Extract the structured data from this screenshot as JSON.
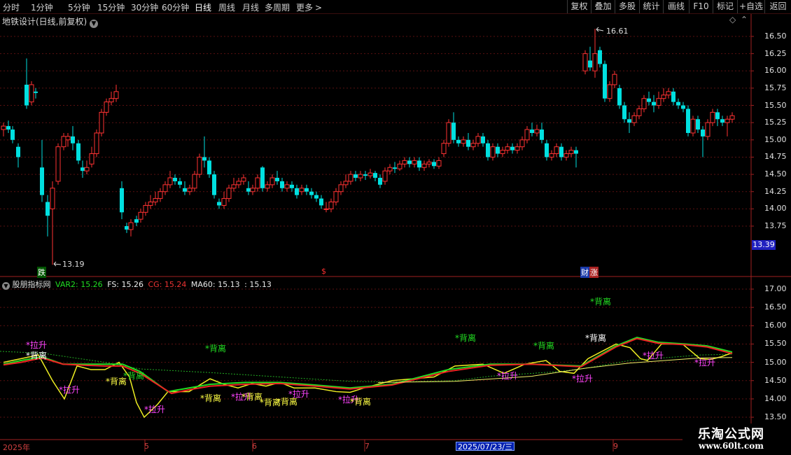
{
  "toolbar": {
    "timeframes": [
      "分时",
      "1分钟",
      "5分钟",
      "15分钟",
      "30分钟",
      "60分钟",
      "日线",
      "周线",
      "月线",
      "多周期",
      "更多"
    ],
    "active_timeframe": "日线",
    "more_arrow": ">",
    "right_buttons": [
      "复权",
      "叠加",
      "多股",
      "统计",
      "画线",
      "F10",
      "标记",
      "+自选",
      "返回"
    ]
  },
  "main_panel": {
    "title": "地铁设计(日线,前复权)",
    "price_axis": [
      "16.50",
      "16.25",
      "16.00",
      "15.75",
      "15.50",
      "15.25",
      "15.00",
      "14.75",
      "14.50",
      "14.25",
      "14.00",
      "13.75"
    ],
    "current_price": "13.39",
    "high_marker": "16.61",
    "low_marker": "13.19",
    "event_labels": {
      "die": "跌",
      "dollar": "$",
      "cai": "财",
      "zhang": "涨"
    }
  },
  "indicator_panel": {
    "name": "股朋指标网",
    "values": [
      {
        "label": "VAR2: 15.26",
        "color": "#22dd22"
      },
      {
        "label": "FS: 15.26",
        "color": "#eeeeee"
      },
      {
        "label": "CG: 15.24",
        "color": "#ee3333"
      },
      {
        "label": "MA60: 15.13",
        "color": "#e8e8e8"
      },
      {
        "label": ": 15.13",
        "color": "#e8e8e8"
      }
    ],
    "axis": [
      "17.00",
      "16.50",
      "16.00",
      "15.50",
      "15.00",
      "14.50",
      "14.00",
      "13.50"
    ],
    "signal_labels": {
      "beili": "*背离",
      "lasheng": "*拉升"
    }
  },
  "x_axis": {
    "labels": [
      "2025年",
      "5",
      "6",
      "7",
      "9"
    ],
    "cursor_date": "2025/07/23/三"
  },
  "watermark": {
    "title": "乐淘公式网",
    "url": "www.60lt.com"
  },
  "colors": {
    "up": "#ff3232",
    "down": "#00e0e0",
    "grid": "#5a1010",
    "axis": "#a02020"
  }
}
